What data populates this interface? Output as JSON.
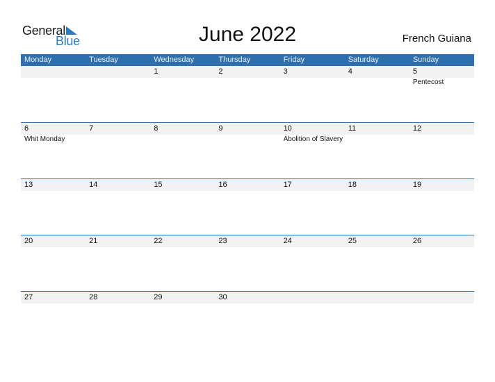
{
  "logo": {
    "line1": "General",
    "line2": "Blue"
  },
  "title": "June 2022",
  "region": "French Guiana",
  "colors": {
    "accent": "#2e6fb0",
    "strip": "#f2f2f2"
  },
  "weekdays": [
    "Monday",
    "Tuesday",
    "Wednesday",
    "Thursday",
    "Friday",
    "Saturday",
    "Sunday"
  ],
  "weeks": [
    {
      "days": [
        "",
        "",
        "1",
        "2",
        "3",
        "4",
        "5"
      ],
      "events": [
        "",
        "",
        "",
        "",
        "",
        "",
        "Pentecost"
      ]
    },
    {
      "days": [
        "6",
        "7",
        "8",
        "9",
        "10",
        "11",
        "12"
      ],
      "events": [
        "Whit Monday",
        "",
        "",
        "",
        "Abolition of Slavery",
        "",
        ""
      ]
    },
    {
      "days": [
        "13",
        "14",
        "15",
        "16",
        "17",
        "18",
        "19"
      ],
      "events": [
        "",
        "",
        "",
        "",
        "",
        "",
        ""
      ]
    },
    {
      "days": [
        "20",
        "21",
        "22",
        "23",
        "24",
        "25",
        "26"
      ],
      "events": [
        "",
        "",
        "",
        "",
        "",
        "",
        ""
      ]
    },
    {
      "days": [
        "27",
        "28",
        "29",
        "30",
        "",
        "",
        ""
      ],
      "events": [
        "",
        "",
        "",
        "",
        "",
        "",
        ""
      ]
    }
  ]
}
